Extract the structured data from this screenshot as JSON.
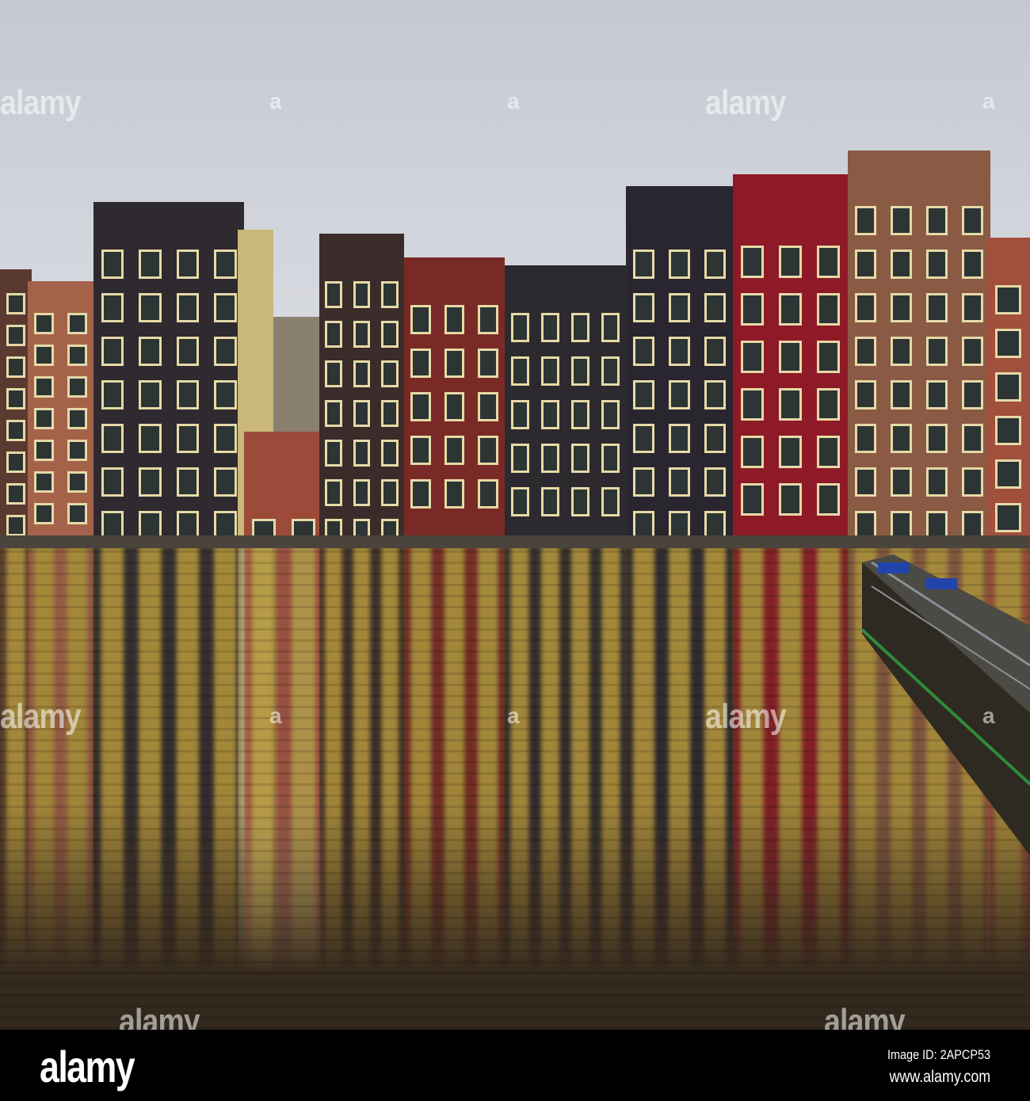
{
  "watermark": {
    "text": "alamy",
    "mark": "a"
  },
  "footer": {
    "logo": "alamy",
    "image_id": "Image ID: 2APCP53",
    "website": "www.alamy.com"
  }
}
